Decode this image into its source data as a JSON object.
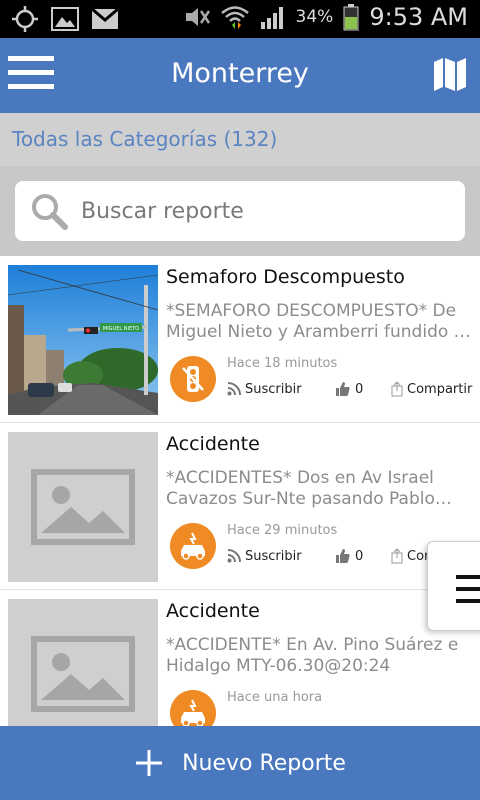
{
  "status_bar": {
    "icons": [
      "gps-icon",
      "gallery-icon",
      "gmail-icon",
      "mute-icon",
      "wifi-icon",
      "signal-icon",
      "battery-icon"
    ],
    "battery": "34%",
    "time": "9:53 AM"
  },
  "app_bar": {
    "title": "Monterrey",
    "menu_icon": "hamburger-icon",
    "map_icon": "map-icon",
    "color": "#4a78bf"
  },
  "category": {
    "label": "Todas las Categorías (132)"
  },
  "search": {
    "placeholder": "Buscar reporte"
  },
  "reports": [
    {
      "title": "Semaforo Descompuesto",
      "description": "*SEMAFORO DESCOMPUESTO* De Miguel Nieto y Aramberri fundido …",
      "time": "Hace 18 minutos",
      "category_icon": "traffic-light-icon",
      "subscribe": "Suscribir",
      "likes": "0",
      "share": "Compartir",
      "image": "street-photo",
      "street_sign": "MIGUEL NIETO"
    },
    {
      "title": "Accidente",
      "description": "*ACCIDENTES* Dos en Av Israel Cavazos Sur-Nte pasando Pablo…",
      "time": "Hace 29 minutos",
      "category_icon": "car-crash-icon",
      "subscribe": "Suscribir",
      "likes": "0",
      "share": "Cor",
      "image": "placeholder"
    },
    {
      "title": "Accidente",
      "description": "*ACCIDENTE* En Av. Pino Suárez e Hidalgo MTY-06.30@20:24",
      "time": "Hace una hora",
      "category_icon": "car-crash-icon",
      "image": "placeholder"
    }
  ],
  "bottom_bar": {
    "label": "Nuevo Reporte",
    "icon": "plus-icon"
  },
  "accent": "#f08a24"
}
